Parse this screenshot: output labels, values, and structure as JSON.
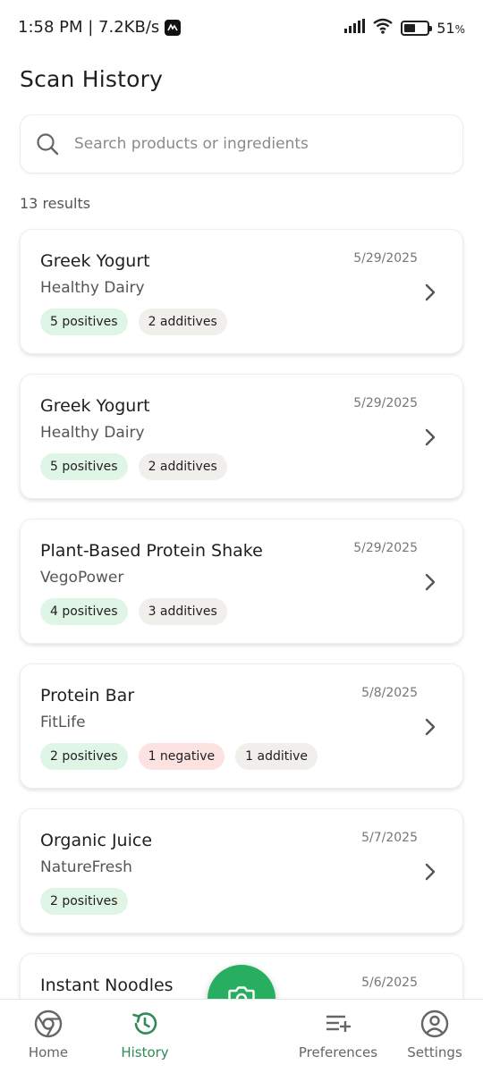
{
  "status_bar": {
    "time_network": "1:58 PM | 7.2KB/s",
    "battery_percent": "51",
    "battery_symbol": "%",
    "battery_level": 0.51
  },
  "header": {
    "title": "Scan History"
  },
  "search": {
    "placeholder": "Search products or ingredients"
  },
  "results": {
    "count_label": "13 results"
  },
  "scans": [
    {
      "name": "Greek Yogurt",
      "brand": "Healthy Dairy",
      "date": "5/29/2025",
      "badges": [
        {
          "text": "5 positives",
          "kind": "pos"
        },
        {
          "text": "2 additives",
          "kind": "add"
        }
      ]
    },
    {
      "name": "Greek Yogurt",
      "brand": "Healthy Dairy",
      "date": "5/29/2025",
      "badges": [
        {
          "text": "5 positives",
          "kind": "pos"
        },
        {
          "text": "2 additives",
          "kind": "add"
        }
      ]
    },
    {
      "name": "Plant-Based Protein Shake",
      "brand": "VegoPower",
      "date": "5/29/2025",
      "badges": [
        {
          "text": "4 positives",
          "kind": "pos"
        },
        {
          "text": "3 additives",
          "kind": "add"
        }
      ]
    },
    {
      "name": "Protein Bar",
      "brand": "FitLife",
      "date": "5/8/2025",
      "badges": [
        {
          "text": "2 positives",
          "kind": "pos"
        },
        {
          "text": "1 negative",
          "kind": "neg"
        },
        {
          "text": "1 additive",
          "kind": "add"
        }
      ]
    },
    {
      "name": "Organic Juice",
      "brand": "NatureFresh",
      "date": "5/7/2025",
      "badges": [
        {
          "text": "2 positives",
          "kind": "pos"
        }
      ]
    },
    {
      "name": "Instant Noodles",
      "brand": "",
      "date": "5/6/2025",
      "badges": []
    }
  ],
  "nav": {
    "home": "Home",
    "history": "History",
    "preferences": "Preferences",
    "settings": "Settings"
  },
  "icons": {
    "search": "search-icon",
    "chevron": "chevron-right-icon",
    "camera": "camera-icon",
    "home": "chrome-style-home-icon",
    "history": "history-icon",
    "preferences": "list-add-icon",
    "settings": "account-circle-icon"
  },
  "colors": {
    "accent": "#27ae60",
    "positive_badge": "#dff5e6",
    "negative_badge": "#fde2e2",
    "additive_badge": "#f1efec"
  }
}
